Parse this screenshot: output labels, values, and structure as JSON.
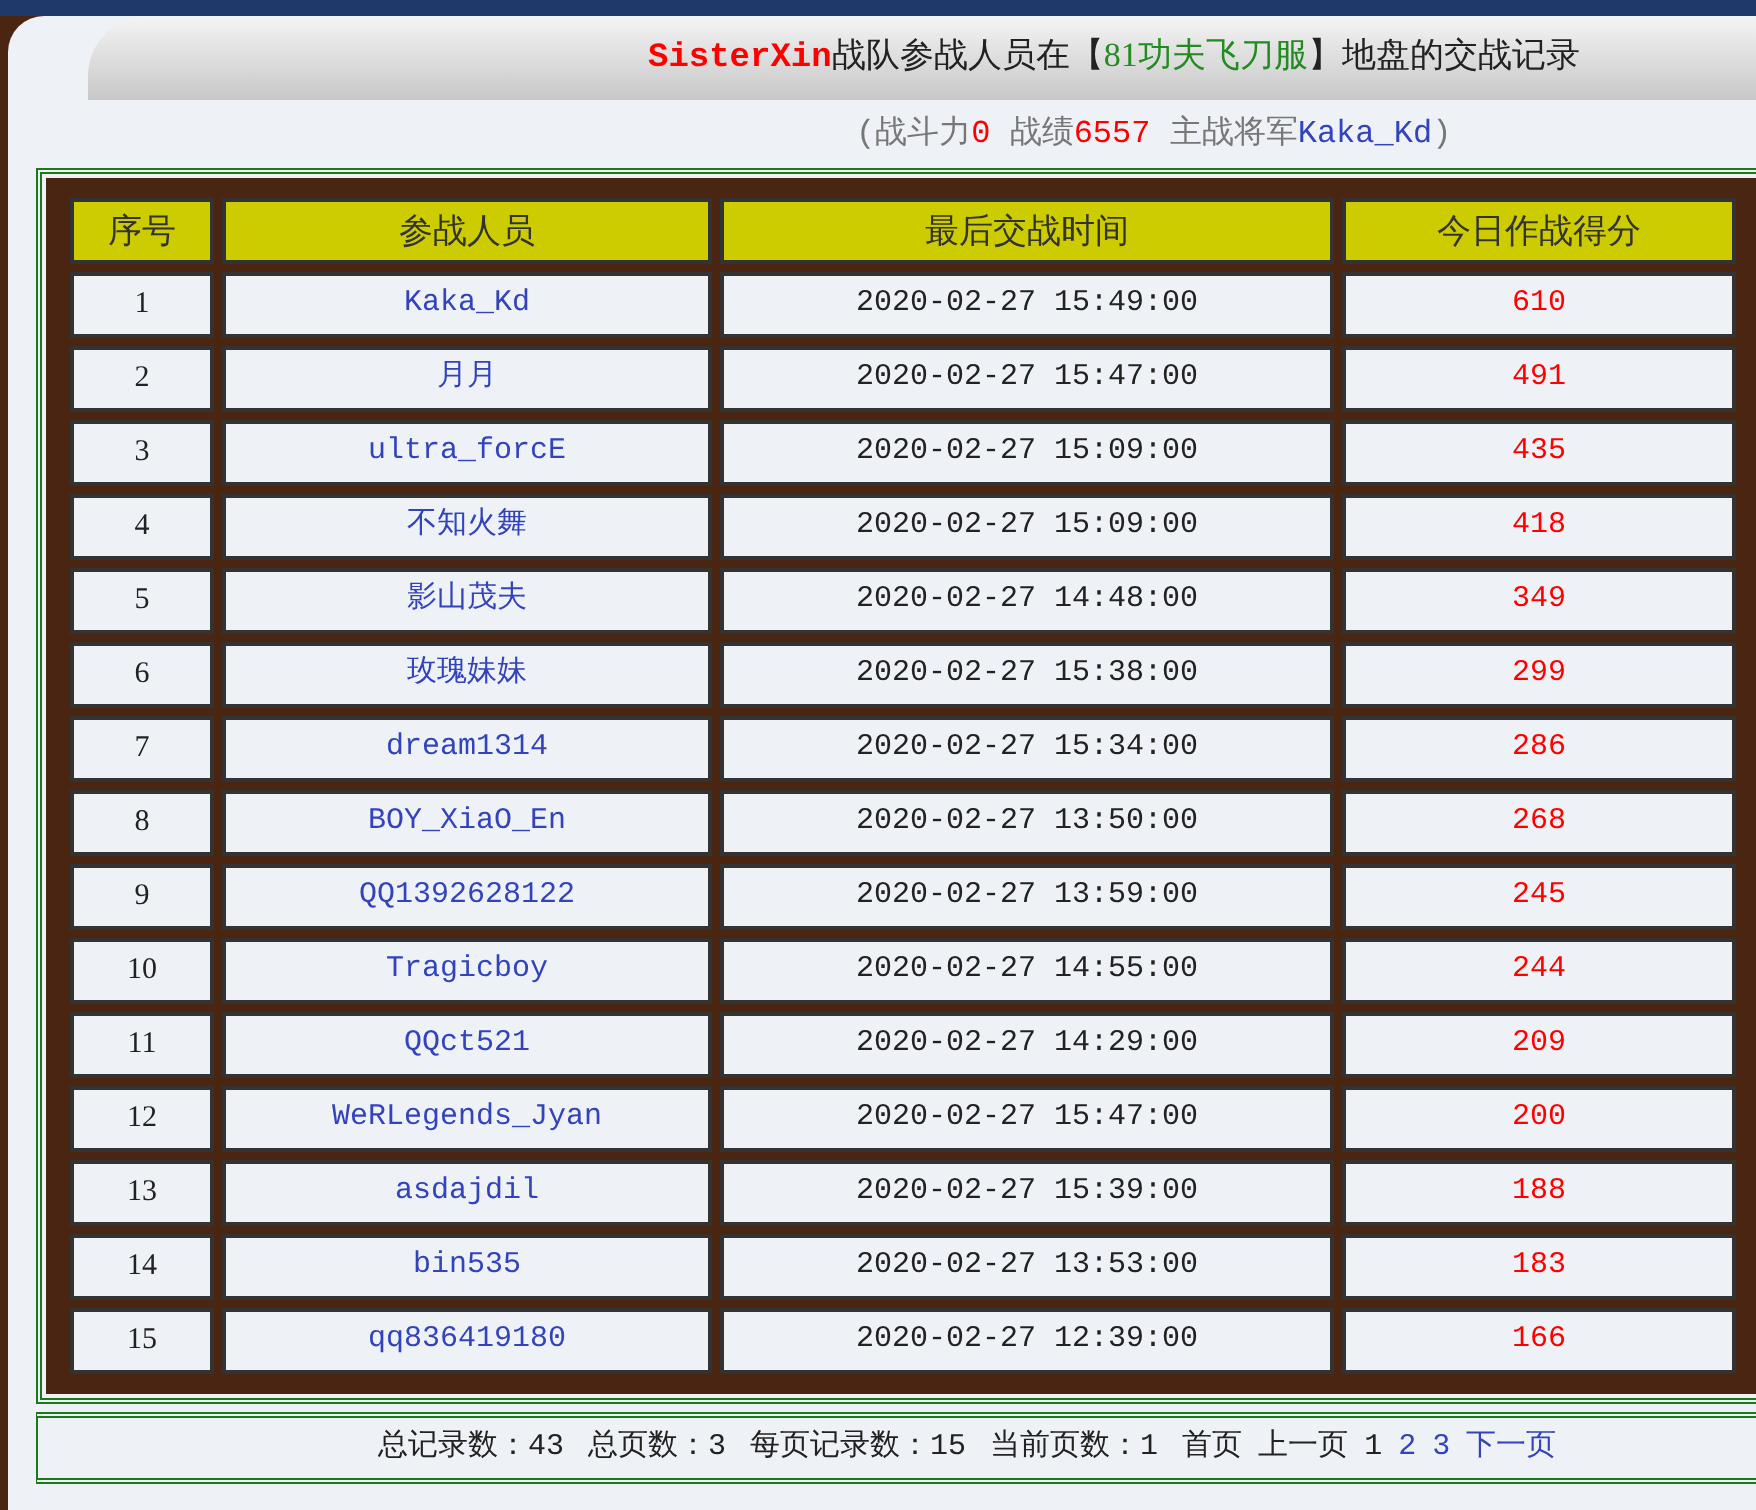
{
  "title": [
    {
      "text": "SisterXin",
      "color": "#ff0000"
    },
    {
      "text": "战队参战人员在【",
      "color": "#222222"
    },
    {
      "text": "81功夫飞刀服",
      "color": "#228b22"
    },
    {
      "text": "】地盘的交战记录",
      "color": "#222222"
    }
  ],
  "subtitle": [
    {
      "text": "(战斗力",
      "color": "#777777"
    },
    {
      "text": "0",
      "color": "#ff0000"
    },
    {
      "text": " 战绩",
      "color": "#777777"
    },
    {
      "text": "6557",
      "color": "#ff0000"
    },
    {
      "text": " 主战将军",
      "color": "#777777"
    },
    {
      "text": "Kaka_Kd",
      "color": "#3344bb"
    },
    {
      "text": ")",
      "color": "#777777"
    }
  ],
  "table": {
    "columns": [
      "序号",
      "参战人员",
      "最后交战时间",
      "今日作战得分"
    ],
    "rows": [
      {
        "no": "1",
        "name": "Kaka_Kd",
        "time": "2020-02-27 15:49:00",
        "score": "610"
      },
      {
        "no": "2",
        "name": "月月",
        "time": "2020-02-27 15:47:00",
        "score": "491"
      },
      {
        "no": "3",
        "name": "ultra_forcE",
        "time": "2020-02-27 15:09:00",
        "score": "435"
      },
      {
        "no": "4",
        "name": "不知火舞",
        "time": "2020-02-27 15:09:00",
        "score": "418"
      },
      {
        "no": "5",
        "name": "影山茂夫",
        "time": "2020-02-27 14:48:00",
        "score": "349"
      },
      {
        "no": "6",
        "name": "玫瑰妹妹",
        "time": "2020-02-27 15:38:00",
        "score": "299"
      },
      {
        "no": "7",
        "name": "dream1314",
        "time": "2020-02-27 15:34:00",
        "score": "286"
      },
      {
        "no": "8",
        "name": "BOY_XiaO_En",
        "time": "2020-02-27 13:50:00",
        "score": "268"
      },
      {
        "no": "9",
        "name": "QQ1392628122",
        "time": "2020-02-27 13:59:00",
        "score": "245"
      },
      {
        "no": "10",
        "name": "Tragicboy",
        "time": "2020-02-27 14:55:00",
        "score": "244"
      },
      {
        "no": "11",
        "name": "QQct521",
        "time": "2020-02-27 14:29:00",
        "score": "209"
      },
      {
        "no": "12",
        "name": "WeRLegends_Jyan",
        "time": "2020-02-27 15:47:00",
        "score": "200"
      },
      {
        "no": "13",
        "name": "asdajdil",
        "time": "2020-02-27 15:39:00",
        "score": "188"
      },
      {
        "no": "14",
        "name": "bin535",
        "time": "2020-02-27 13:53:00",
        "score": "183"
      },
      {
        "no": "15",
        "name": "qq836419180",
        "time": "2020-02-27 12:39:00",
        "score": "166"
      }
    ]
  },
  "pagination": {
    "stats": [
      "总记录数：43",
      "总页数：3",
      "每页记录数：15",
      "当前页数：1"
    ],
    "links": [
      {
        "text": "首页",
        "link": false
      },
      {
        "text": "上一页",
        "link": false
      },
      {
        "text": "1",
        "link": false
      },
      {
        "text": "2",
        "link": true
      },
      {
        "text": "3",
        "link": true
      },
      {
        "text": "下一页",
        "link": true
      }
    ]
  }
}
